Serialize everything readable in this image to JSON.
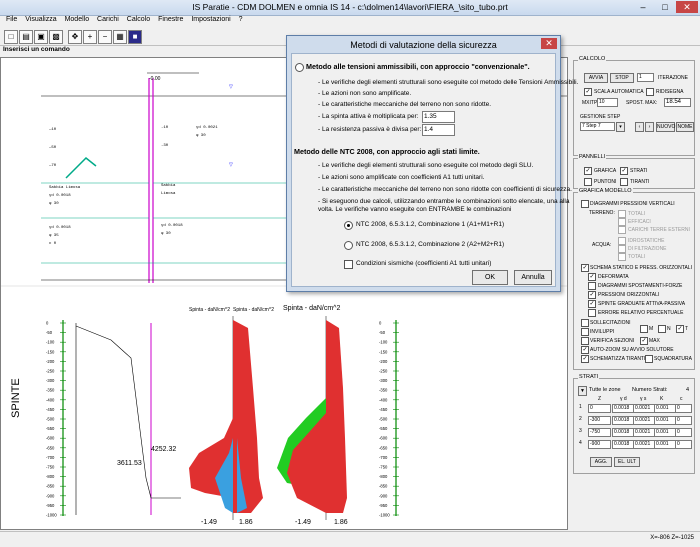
{
  "window": {
    "title": "IS Paratie - CDM DOLMEN e omnia IS 14 - c:\\dolmen14\\lavori\\FIERA_\\sito_tubo.prt"
  },
  "menu": [
    "File",
    "Visualizza",
    "Modello",
    "Carichi",
    "Calcolo",
    "Finestre",
    "Impostazioni",
    "?"
  ],
  "command_label": "Inserisci un comando",
  "status_right": "X=-806 Z=-1025",
  "drawing": {
    "left_chart_title": "Spinta - daN/cm^2",
    "left_chart_title2": "Spinta - daN/cm^2",
    "right_chart_title": "Spinta - daN/cm^2",
    "side_label": "SPINTE",
    "annot1": "4252.32",
    "annot2": "3611.53",
    "bottom_left_a": "-1.49",
    "bottom_left_b": "1.86",
    "bottom_right_a": "-1.49",
    "bottom_right_b": "1.86",
    "depth_ticks": [
      "0",
      "-50",
      "-100",
      "-150",
      "-200",
      "-250",
      "-300",
      "-350",
      "-400",
      "-450",
      "-500",
      "-550",
      "-600",
      "-650",
      "-700",
      "-750",
      "-800",
      "-850",
      "-900",
      "-950",
      "-1000"
    ]
  },
  "panel": {
    "calcolo_title": "CALCOLO",
    "avvia": "AVVIA",
    "stop": "STOP",
    "iter_value": "1",
    "iterazione": "ITERAZIONE",
    "scala_auto": "SCALA AUTOMATICA",
    "ridisegna": "RIDISEGNA",
    "maxitp": "MXITP",
    "maxitp_value": "10",
    "spost_max": "SPOST. MAX:",
    "spost_value": "18.54",
    "gestione_step": "GESTIONE STEP",
    "step_value": "7 Step 7",
    "nuovo": "NUOVO",
    "nome": "NOME",
    "pannelli": "PANNELLI",
    "grafica": "GRAFICA",
    "strati": "STRATI",
    "puntoni": "PUNTONI",
    "tiranti": "TIRANTI",
    "grafica_modello": "GRAFICA MODELLO",
    "diag_press": "DIAGRAMMI PRESSIONI VERTICALI",
    "terreno": "TERRENO:",
    "totali": "TOTALI",
    "efficaci": "EFFICACI",
    "carichi_terre": "CARICHI TERRE ESTERNI",
    "acqua": "ACQUA:",
    "idrostatiche": "IDROSTATICHE",
    "di_filtrazione": "DI FILTRAZIONE",
    "totali2": "TOTALI",
    "schema_statico": "SCHEMA STATICO E PRESS. ORIZZONTALI",
    "deformata": "DEFORMATA",
    "diagrammi_spost": "DIAGRAMMI SPOSTAMENTI-FORZE",
    "pressioni_orizz": "PRESSIONI ORIZZONTALI",
    "spinte_grad": "SPINTE GRADUATE ATTIVA-PASSIVA",
    "errore_rel": "ERRORE RELATIVO PERCENTUALE",
    "sollecitazioni": "SOLLECITAZIONI",
    "m_label": "M",
    "n_label": "N",
    "t_label": "T",
    "inviluppi": "INVILUPPI",
    "verifica_sezioni": "VERIFICA SEZIONI",
    "max_label": "MAX",
    "auto_zoom": "AUTO-ZOOM SU AVVIO SOLUTORE",
    "schematizza": "SCHEMATIZZA TIRANTI",
    "squadratura": "SQUADRATURA",
    "strati_title": "STRATI",
    "tutte_zone": "Tutte le zone",
    "numero_strati": "Numero Strati:",
    "numero_strati_value": "4",
    "cols": [
      "Z",
      "γ d",
      "γ s",
      "K",
      "c"
    ],
    "rows": [
      {
        "n": "1",
        "z": "0",
        "gd": "0.0018",
        "gs": "0.0021",
        "k": "0.001",
        "c": "0"
      },
      {
        "n": "2",
        "z": "-300",
        "gd": "0.0018",
        "gs": "0.0021",
        "k": "0.001",
        "c": "0"
      },
      {
        "n": "3",
        "z": "-750",
        "gd": "0.0018",
        "gs": "0.0021",
        "k": "0.001",
        "c": "0"
      },
      {
        "n": "4",
        "z": "-900",
        "gd": "0.0018",
        "gs": "0.0021",
        "k": "0.001",
        "c": "0"
      }
    ],
    "agg": "AGG.",
    "el_ult": "EL. ULT"
  },
  "dialog": {
    "title": "Metodi di valutazione della sicurezza",
    "opt1": "Metodo alle tensioni ammissibili, con approccio \"convenzionale\".",
    "opt1_lines": [
      "- Le verifiche degli elementi strutturali sono eseguite col metodo delle Tensioni Ammissibili.",
      "- Le azioni non sono amplificate.",
      "- Le caratteristiche meccaniche del terreno non sono ridotte."
    ],
    "spinta_attiva": "- La spinta attiva è moltiplicata per:",
    "spinta_attiva_value": "1.35",
    "resist_passiva": "- La resistenza passiva è divisa per:",
    "resist_passiva_value": "1.4",
    "opt2": "Metodo delle NTC 2008, con approccio agli stati limite.",
    "opt2_lines": [
      "- Le verifiche degli elementi strutturali sono eseguite col metodo degli SLU.",
      "- Le azioni sono amplificate con coefficienti A1 tutti unitari.",
      "- Le caratteristiche meccaniche del terreno non sono ridotte con coefficienti di sicurezza.",
      "- Si eseguono due calcoli, utilizzando entrambe le combinazioni sotto elencate, una alla",
      "volta. Le verifiche vanno eseguite con ENTRAMBE le combinazioni"
    ],
    "comb1": "NTC 2008, 6.5.3.1.2, Combinazione 1 (A1+M1+R1)",
    "comb2": "NTC 2008, 6.5.3.1.2, Combinazione 2 (A2+M2+R1)",
    "sismiche": "Condizioni sismiche (coefficienti A1 tutti unitari)",
    "ok": "OK",
    "annulla": "Annulla"
  }
}
